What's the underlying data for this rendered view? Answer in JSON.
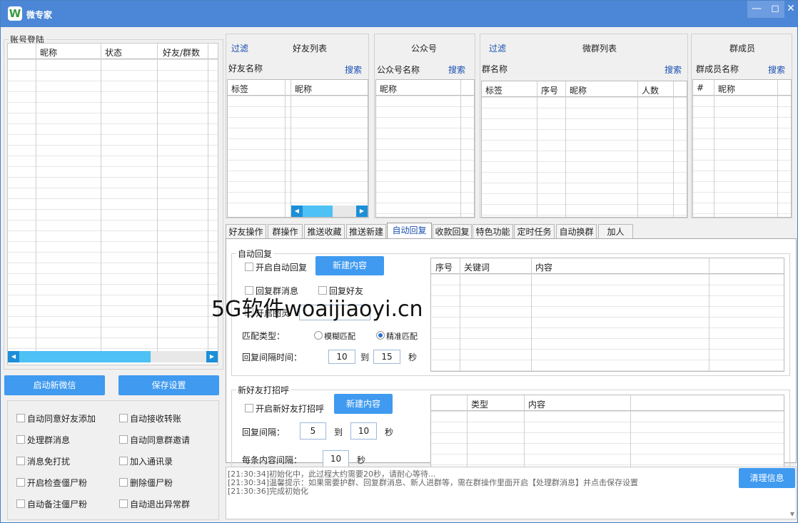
{
  "app": {
    "title": "微专家",
    "logo_letter": "W"
  },
  "account": {
    "legend": "账号登陆",
    "columns": [
      "昵称",
      "状态",
      "好友/群数"
    ],
    "start_button": "启动新微信",
    "save_button": "保存设置"
  },
  "options": [
    "自动同意好友添加",
    "自动接收转账",
    "处理群消息",
    "自动同意群邀请",
    "消息免打扰",
    "加入通讯录",
    "开启检查僵尸粉",
    "删除僵尸粉",
    "自动备注僵尸粉",
    "自动退出异常群"
  ],
  "friends": {
    "filter": "过滤",
    "title": "好友列表",
    "name_label": "好友名称",
    "search": "搜索",
    "col_tag": "标签",
    "col_nick": "昵称"
  },
  "public": {
    "title": "公众号",
    "name_label": "公众号名称",
    "search": "搜索",
    "col_nick": "昵称"
  },
  "groups": {
    "filter": "过滤",
    "title": "微群列表",
    "name_label": "群名称",
    "search": "搜索",
    "col_tag": "标签",
    "col_no": "序号",
    "col_nick": "昵称",
    "col_count": "人数"
  },
  "members": {
    "title": "群成员",
    "name_label": "群成员名称",
    "search": "搜索",
    "col_hash": "#",
    "col_nick": "昵称"
  },
  "tabs": [
    "好友操作",
    "群操作",
    "推送收藏",
    "推送新建",
    "自动回复",
    "收款回复",
    "特色功能",
    "定时任务",
    "自动换群",
    "加人"
  ],
  "active_tab": "自动回复",
  "auto_reply": {
    "legend": "自动回复",
    "enable": "开启自动回复",
    "new_content": "新建内容",
    "reply_group": "回复群消息",
    "reply_friend": "回复好友",
    "enable_lingling": "开启图灵",
    "match_type_label": "匹配类型：",
    "fuzzy": "模糊匹配",
    "exact": "精准匹配",
    "interval_label": "回复间隔时间：",
    "interval_from": "10",
    "to": "到",
    "interval_to": "15",
    "unit": "秒",
    "table_cols": [
      "序号",
      "关键词",
      "内容"
    ]
  },
  "greeting": {
    "legend": "新好友打招呼",
    "enable": "开启新好友打招呼",
    "new_content": "新建内容",
    "interval_label": "回复间隔：",
    "from": "5",
    "to": "到",
    "to_val": "10",
    "unit": "秒",
    "each_label": "每条内容间隔：",
    "each_val": "10",
    "each_unit": "秒",
    "table_cols": [
      "类型",
      "内容"
    ]
  },
  "log": {
    "lines": [
      "[21:30:34]初始化中，此过程大约需要20秒，请耐心等待...",
      "[21:30:34]温馨提示：如果需要护群、回复群消息、新人进群等，需在群操作里面开启【处理群消息】并点击保存设置",
      "[21:30:36]完成初始化"
    ],
    "clear_button": "清理信息"
  },
  "watermark": "5G软件woaijiaoyi.cn"
}
